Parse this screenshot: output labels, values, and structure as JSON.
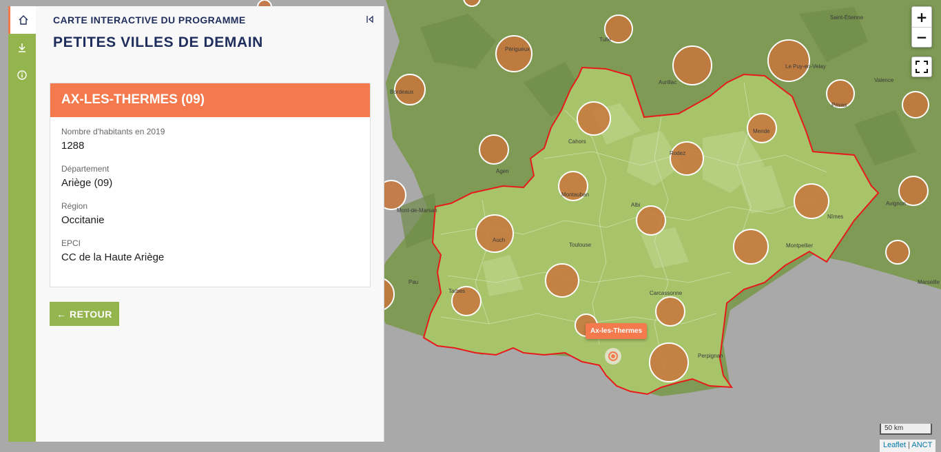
{
  "panel": {
    "subtitle": "CARTE INTERACTIVE DU PROGRAMME",
    "title": "PETITES VILLES DE DEMAIN",
    "rail": [
      "home-icon",
      "download-icon",
      "info-icon"
    ]
  },
  "commune": {
    "name": "AX-LES-THERMES (09)",
    "fields": [
      {
        "label": "Nombre d'habitants en 2019",
        "value": "1288"
      },
      {
        "label": "Département",
        "value": "Ariège (09)"
      },
      {
        "label": "Région",
        "value": "Occitanie"
      },
      {
        "label": "EPCI",
        "value": "CC de la Haute Ariège"
      }
    ]
  },
  "back_label": "← RETOUR",
  "map": {
    "tooltip": "Ax-les-Thermes",
    "zoom_in": "+",
    "zoom_out": "−",
    "scale": "50 km",
    "attribution_1": "Leaflet",
    "attribution_sep": " | ",
    "attribution_2": "ANCT",
    "labels": [
      "Tulle",
      "Périgueux",
      "Saint-Étienne",
      "Bordeaux",
      "Aurillac",
      "Le Puy-en-Velay",
      "Valence",
      "Privas",
      "Mende",
      "Cahors",
      "Rodez",
      "Agen",
      "Montauban",
      "Albi",
      "Nîmes",
      "Avignon",
      "Mont-de-Marsan",
      "Auch",
      "Toulouse",
      "Montpellier",
      "Pau",
      "Tarbes",
      "Carcassonne",
      "Marseille",
      "Perpignan"
    ],
    "colors": {
      "region_fill": "#a7c46a",
      "outside": "#7e9a55",
      "sea": "#a9a9a9",
      "border": "#e8191a",
      "circle": "#c8753c",
      "accent": "#f47a4e"
    }
  }
}
